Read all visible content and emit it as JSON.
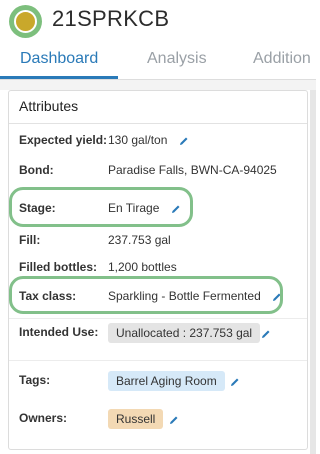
{
  "header": {
    "title": "21SPRKCB",
    "logo_icon": "winery-logo"
  },
  "tabs": [
    {
      "label": "Dashboard",
      "active": true
    },
    {
      "label": "Analysis",
      "active": false
    },
    {
      "label": "Addition",
      "active": false
    }
  ],
  "card": {
    "title": "Attributes",
    "rows": {
      "expected_yield": {
        "label": "Expected yield:",
        "value": "130 gal/ton"
      },
      "bond": {
        "label": "Bond:",
        "value": "Paradise Falls, BWN-CA-94025"
      },
      "stage": {
        "label": "Stage:",
        "value": "En Tirage"
      },
      "fill": {
        "label": "Fill:",
        "value": "237.753 gal"
      },
      "filled_bottles": {
        "label": "Filled bottles:",
        "value": "1,200 bottles"
      },
      "tax_class": {
        "label": "Tax class:",
        "value": "Sparkling - Bottle Fermented"
      },
      "intended_use": {
        "label": "Intended Use:",
        "value": "Unallocated : 237.753 gal"
      },
      "tags": {
        "label": "Tags:",
        "value": "Barrel Aging Room"
      },
      "owners": {
        "label": "Owners:",
        "value": "Russell"
      }
    }
  },
  "colors": {
    "accent": "#2a7ab8",
    "highlight": "#82c08a",
    "tag_blue": "#d6e9f8",
    "owner_tan": "#f3d9b4",
    "use_gray": "#e4e4e4"
  }
}
